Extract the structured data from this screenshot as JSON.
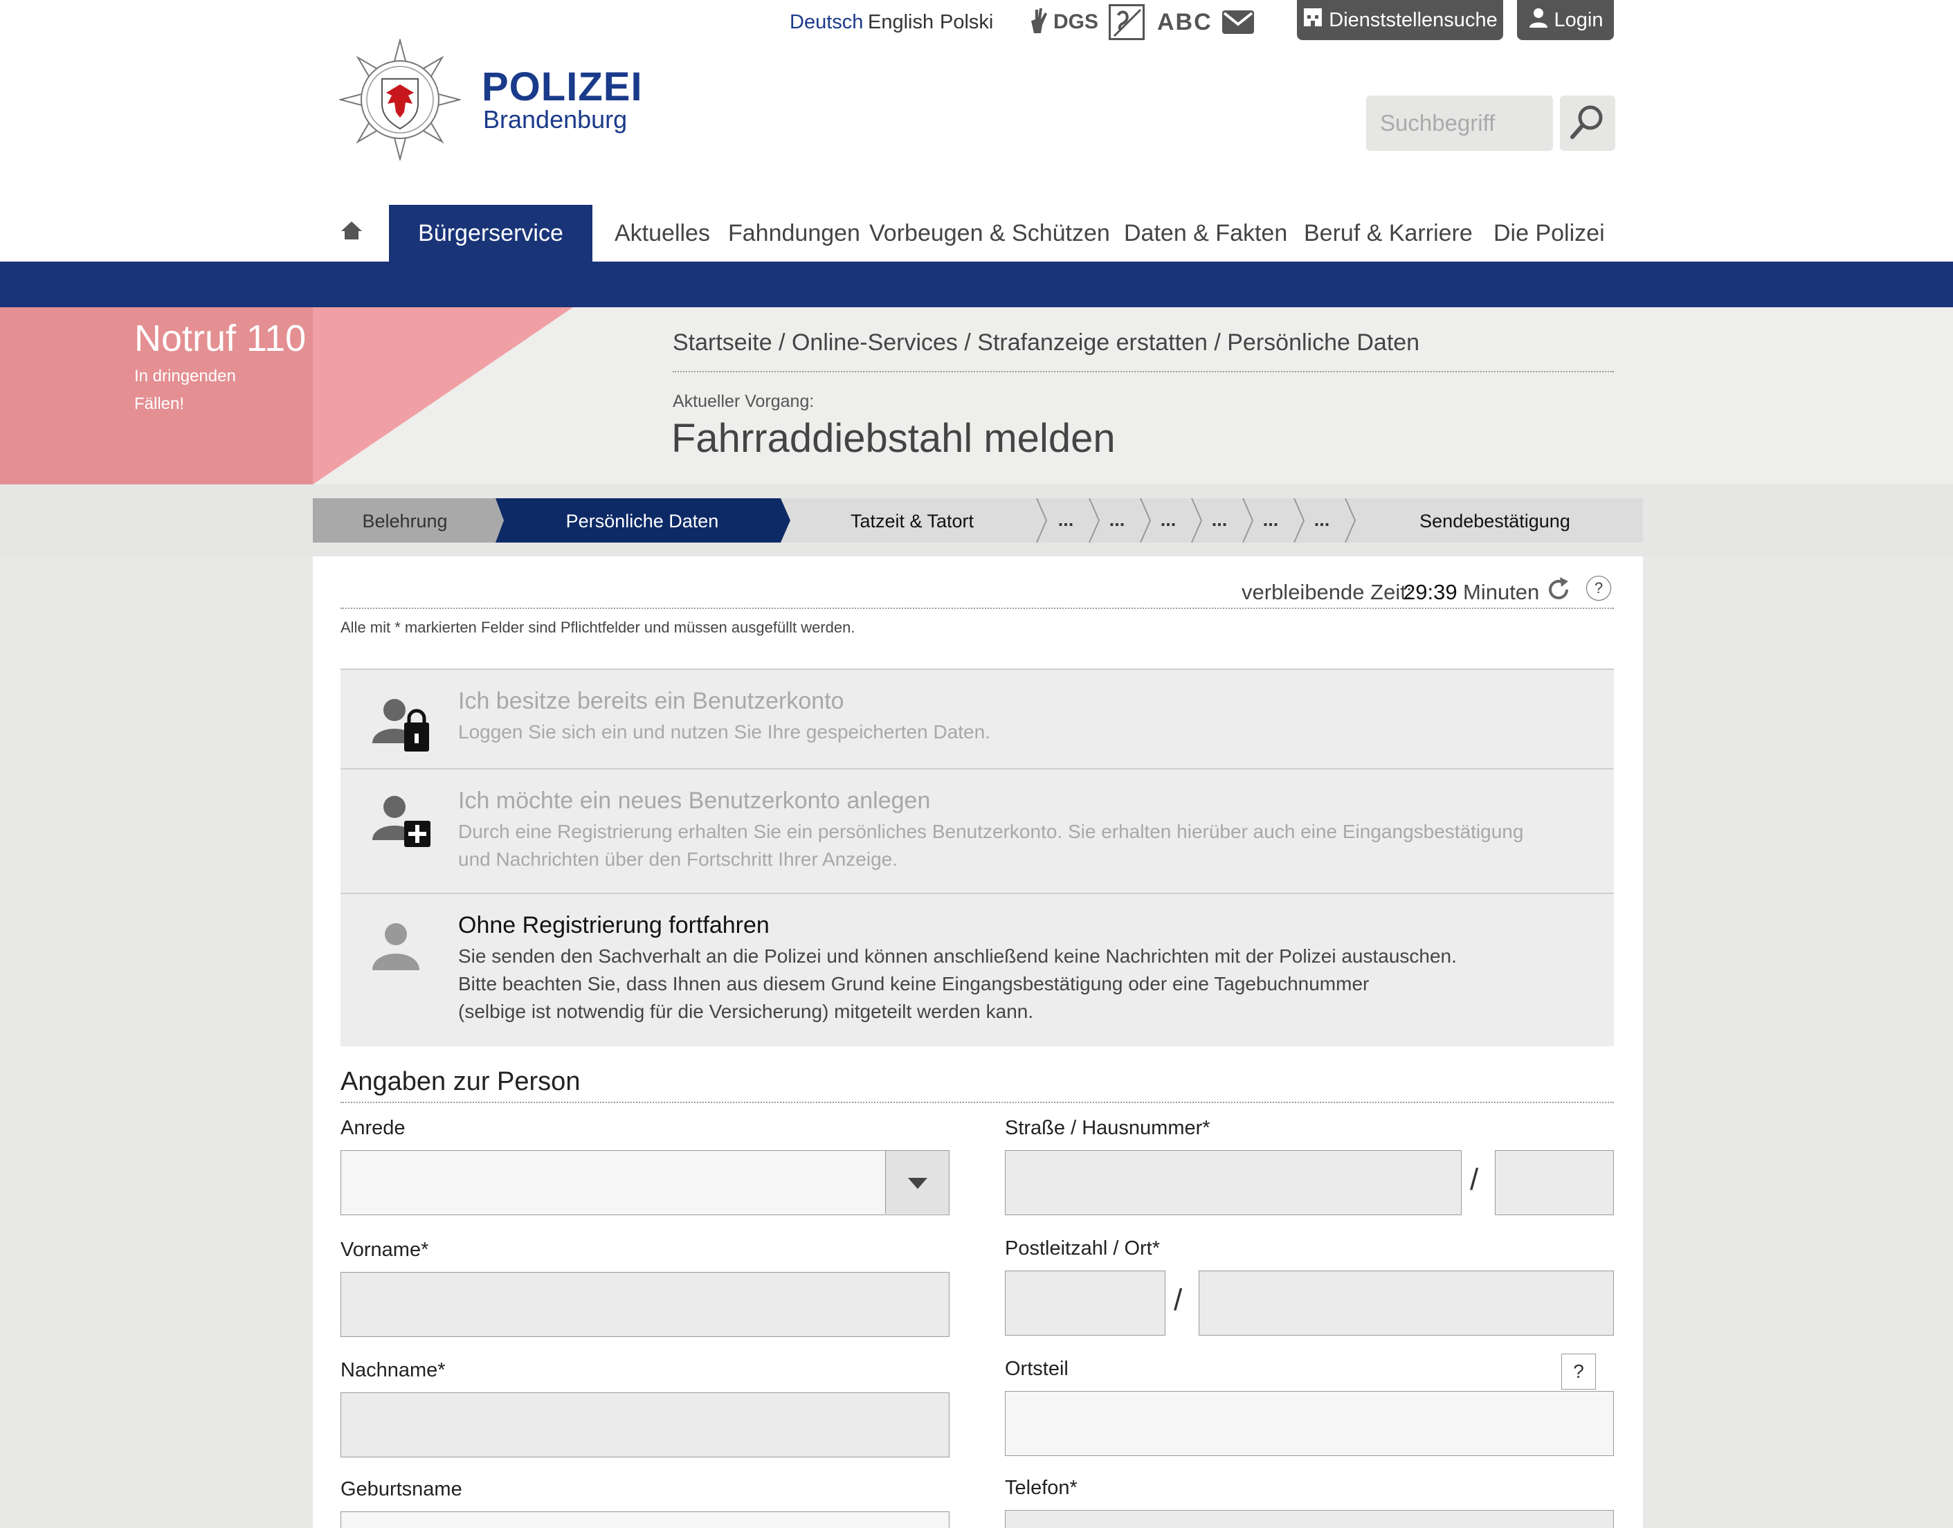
{
  "header": {
    "languages": [
      "Deutsch",
      "English",
      "Polski"
    ],
    "active_language": "Deutsch",
    "accessibility": {
      "sign_language_label": "DGS",
      "easy_language_label": "ABC"
    },
    "dienststellen_button": "Dienststellensuche",
    "login_button": "Login",
    "logo_title": "POLIZEI",
    "logo_subtitle": "Brandenburg",
    "search_placeholder": "Suchbegriff"
  },
  "nav": {
    "items": [
      "Bürgerservice",
      "Aktuelles",
      "Fahndungen",
      "Vorbeugen & Schützen",
      "Daten & Fakten",
      "Beruf & Karriere",
      "Die Polizei"
    ],
    "active": "Bürgerservice"
  },
  "notruf": {
    "title": "Notruf 110",
    "subtitle": "In dringenden Fällen!"
  },
  "breadcrumb": "Startseite / Online-Services / Strafanzeige erstatten / Persönliche Daten",
  "process": {
    "label": "Aktueller Vorgang:",
    "title": "Fahrraddiebstahl melden"
  },
  "steps": {
    "items": [
      "Belehrung",
      "Persönliche Daten",
      "Tatzeit & Tatort",
      "...",
      "...",
      "...",
      "...",
      "...",
      "...",
      "Sendebestätigung"
    ],
    "done": "Belehrung",
    "active": "Persönliche Daten"
  },
  "timer": {
    "label": "verbleibende Zeit:",
    "value": "29:39",
    "unit": "Minuten",
    "help": "?"
  },
  "required_note": "Alle mit * markierten Felder sind Pflichtfelder und müssen ausgefüllt werden.",
  "account_options": [
    {
      "title": "Ich besitze bereits ein Benutzerkonto",
      "desc": [
        "Loggen Sie sich ein und nutzen Sie Ihre gespeicherten Daten."
      ],
      "icon": "user-lock-icon"
    },
    {
      "title": "Ich möchte ein neues Benutzerkonto anlegen",
      "desc": [
        "Durch eine Registrierung erhalten Sie ein persönliches Benutzerkonto. Sie erhalten hierüber auch eine Eingangsbestätigung",
        "und Nachrichten über den Fortschritt Ihrer Anzeige."
      ],
      "icon": "user-add-icon"
    },
    {
      "title": "Ohne Registrierung fortfahren",
      "desc": [
        "Sie senden den Sachverhalt an die Polizei und können anschließend keine Nachrichten mit der Polizei austauschen.",
        "Bitte beachten Sie, dass Ihnen aus diesem Grund keine Eingangsbestätigung oder eine Tagebuchnummer",
        "(selbige ist notwendig für die Versicherung) mitgeteilt werden kann."
      ],
      "icon": "user-icon"
    }
  ],
  "form": {
    "section_title": "Angaben zur Person",
    "labels": {
      "anrede": "Anrede",
      "vorname": "Vorname*",
      "nachname": "Nachname*",
      "geburtsname": "Geburtsname",
      "strasse": "Straße / Hausnummer*",
      "plz_ort": "Postleitzahl / Ort*",
      "ortsteil": "Ortsteil",
      "telefon": "Telefon*"
    },
    "separator": "/",
    "ortsteil_help": "?",
    "anrede_value": ""
  },
  "colors": {
    "primary": "#1a3478",
    "brand_text": "#1a3a8a",
    "notruf": "#e48f92",
    "step_done": "#a9a9a9",
    "step_active": "#0d2a66"
  }
}
